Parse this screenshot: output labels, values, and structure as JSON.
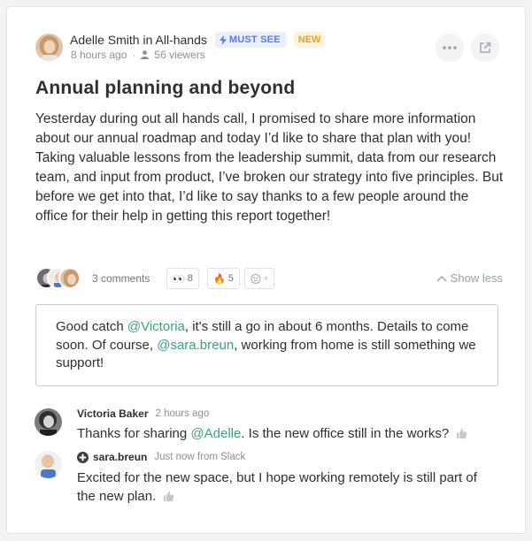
{
  "post": {
    "author": "Adelle Smith",
    "connector": "in",
    "channel": "All-hands",
    "badge_must_see": "MUST SEE",
    "badge_new": "NEW",
    "time": "8 hours ago",
    "viewers": "56 viewers",
    "title": "Annual planning and beyond",
    "body": "Yesterday during out all hands call, I promised to share more information about our annual roadmap and today I’d like to share that plan with you! Taking valuable lessons from the leadership summit, data from our research team, and input from product, I’ve broken our strategy into five principles. But before we get into that, I’d like to say thanks to a few people around the office for their help in getting this report together!"
  },
  "engagement": {
    "comments": "3 comments",
    "reactions": [
      {
        "emoji": "👀",
        "count": "8"
      },
      {
        "emoji": "🔥",
        "count": "5"
      }
    ],
    "add_reaction_plus": "+",
    "show_less": "Show less"
  },
  "reply": {
    "part1": "Good catch ",
    "mention1": "@Victoria",
    "part2": ", it's still a go in about 6 months. Details to come soon. Of course, ",
    "mention2": "@sara.breun",
    "part3": ", working from home is still something we support!"
  },
  "comments": [
    {
      "name": "Victoria Baker",
      "time": "2 hours ago",
      "part1": "Thanks for sharing ",
      "mention": "@Adelle",
      "part2": ". Is the new office still in the works?"
    },
    {
      "name": "sara.breun",
      "time": "Just now from Slack",
      "text": "Excited for the new space, but I hope working remotely is still part of the new plan."
    }
  ],
  "colors": {
    "accent_green": "#3aa37c",
    "must_see_blue": "#5b7be0",
    "new_orange": "#e6a229"
  }
}
